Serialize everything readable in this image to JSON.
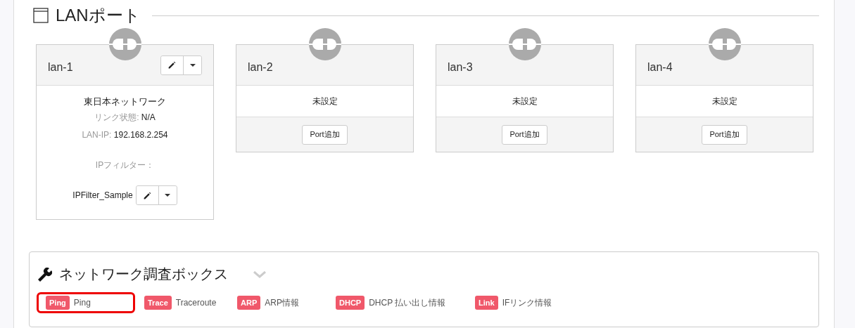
{
  "section": {
    "title": "LANポート"
  },
  "ports": [
    {
      "kind": "configured",
      "name": "lan-1",
      "network": "東日本ネットワーク",
      "link_label": "リンク状態:",
      "link_value": "N/A",
      "ip_label": "LAN-IP:",
      "ip_value": "192.168.2.254",
      "filter_label": "IPフィルター：",
      "filter_name": "IPFilter_Sample"
    },
    {
      "kind": "empty",
      "name": "lan-2",
      "status": "未設定",
      "add_button": "Port追加"
    },
    {
      "kind": "empty",
      "name": "lan-3",
      "status": "未設定",
      "add_button": "Port追加"
    },
    {
      "kind": "empty",
      "name": "lan-4",
      "status": "未設定",
      "add_button": "Port追加"
    }
  ],
  "toolbox": {
    "title": "ネットワーク調査ボックス",
    "tools": [
      {
        "badge": "Ping",
        "label": "Ping",
        "selected": true
      },
      {
        "badge": "Trace",
        "label": "Traceroute",
        "selected": false
      },
      {
        "badge": "ARP",
        "label": "ARP情報",
        "selected": false
      },
      {
        "badge": "DHCP",
        "label": "DHCP 払い出し情報",
        "selected": false
      },
      {
        "badge": "Link",
        "label": "IFリンク情報",
        "selected": false
      }
    ]
  }
}
